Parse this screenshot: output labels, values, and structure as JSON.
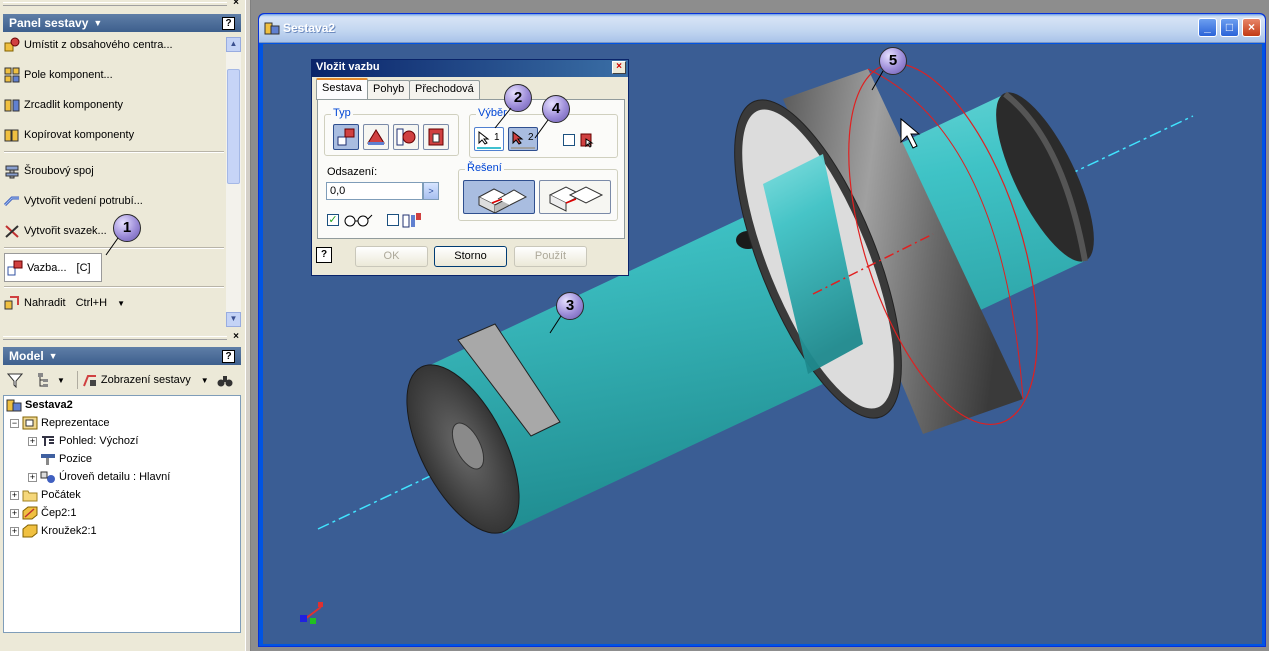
{
  "panel": {
    "title": "Panel sestavy",
    "items": [
      {
        "label": "Umístit z obsahového centra..."
      },
      {
        "label": "Pole komponent..."
      },
      {
        "label": "Zrcadlit komponenty"
      },
      {
        "label": "Kopírovat komponenty"
      },
      {
        "label": "Šroubový spoj"
      },
      {
        "label": "Vytvořit vedení potrubí..."
      },
      {
        "label": "Vytvořit svazek..."
      },
      {
        "label": "Vazba...",
        "shortcut": "[C]"
      },
      {
        "label": "Nahradit",
        "shortcut": "Ctrl+H"
      }
    ]
  },
  "model": {
    "title": "Model",
    "view_label": "Zobrazení sestavy",
    "tree": [
      {
        "label": "Sestava2"
      },
      {
        "label": "Reprezentace"
      },
      {
        "label": "Pohled: Výchozí"
      },
      {
        "label": "Pozice"
      },
      {
        "label": "Úroveň detailu : Hlavní"
      },
      {
        "label": "Počátek"
      },
      {
        "label": "Čep2:1"
      },
      {
        "label": "Kroužek2:1"
      }
    ]
  },
  "window": {
    "title": "Sestava2"
  },
  "dialog": {
    "title": "Vložit vazbu",
    "tabs": [
      {
        "label": "Sestava"
      },
      {
        "label": "Pohyb"
      },
      {
        "label": "Přechodová"
      }
    ],
    "type_label": "Typ",
    "selection_label": "Výběr",
    "offset_label": "Odsazení:",
    "offset_value": "0,0",
    "solution_label": "Řešení",
    "sel1": "1",
    "sel2": "2",
    "ok": "OK",
    "cancel": "Storno",
    "apply": "Použít",
    "help": "?"
  },
  "callouts": [
    "1",
    "2",
    "3",
    "4",
    "5"
  ],
  "colors": {
    "viewport_bg": "#3a5d94",
    "shaft": "#3fc3c6",
    "ring": "#7a7a7a",
    "axis": "#41e4ff",
    "title_bar": "#3d5f8d"
  }
}
